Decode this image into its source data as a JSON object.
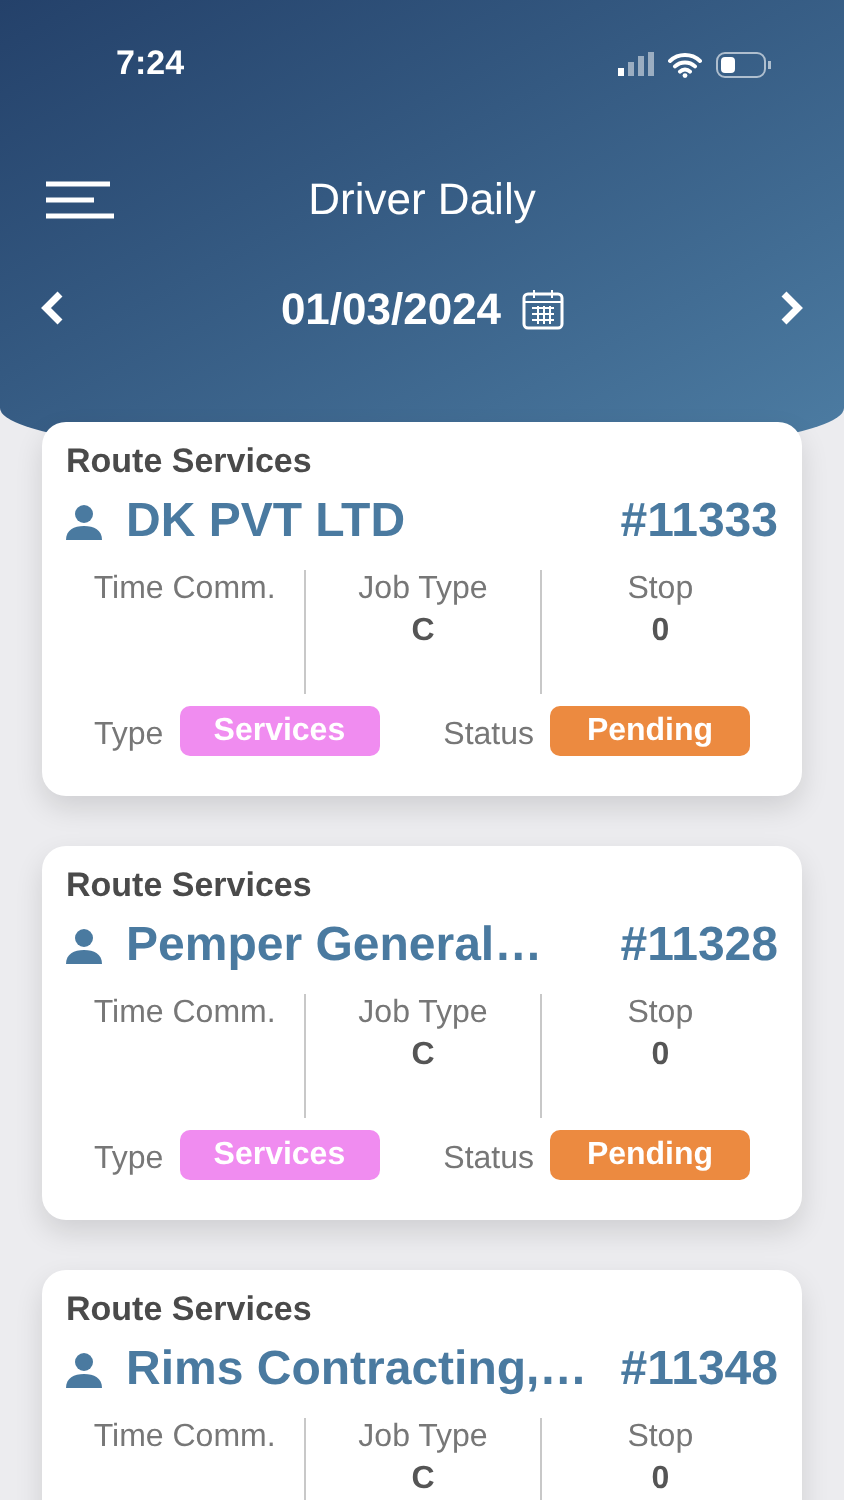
{
  "status_bar": {
    "time": "7:24"
  },
  "header": {
    "title": "Driver Daily",
    "date": "01/03/2024"
  },
  "jobs": [
    {
      "category": "Route Services",
      "customer": "DK PVT LTD",
      "number": "#11333",
      "fields": [
        {
          "label": "Time Comm."
        },
        {
          "label": "Job Type",
          "value": "C"
        },
        {
          "label": "Stop",
          "value": "0"
        }
      ],
      "type_label": "Type",
      "type": {
        "text": "Services",
        "color": "#f08cf0"
      },
      "status_label": "Status",
      "status": {
        "text": "Pending",
        "color": "#ec8a40"
      }
    },
    {
      "category": "Route Services",
      "customer": "Pemper General…",
      "number": "#11328",
      "fields": [
        {
          "label": "Time Comm."
        },
        {
          "label": "Job Type",
          "value": "C"
        },
        {
          "label": "Stop",
          "value": "0"
        }
      ],
      "type_label": "Type",
      "type": {
        "text": "Services",
        "color": "#f08cf0"
      },
      "status_label": "Status",
      "status": {
        "text": "Pending",
        "color": "#ec8a40"
      }
    },
    {
      "category": "Route Services",
      "customer": "Rims Contracting,…",
      "number": "#11348",
      "fields": [
        {
          "label": "Time Comm."
        },
        {
          "label": "Job Type",
          "value": "C"
        },
        {
          "label": "Stop",
          "value": "0"
        }
      ]
    }
  ]
}
